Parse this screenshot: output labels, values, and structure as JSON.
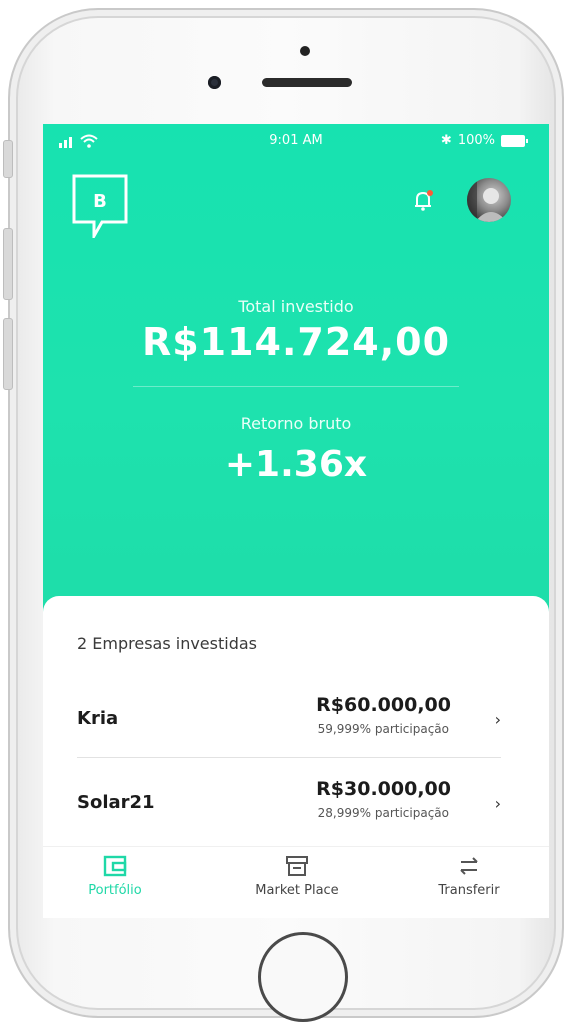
{
  "status_bar": {
    "time": "9:01 AM",
    "battery": "100%"
  },
  "header": {
    "logo_letter": "B",
    "notification_dot_color": "#ff5a36"
  },
  "summary": {
    "total_label": "Total investido",
    "total_value": "R$114.724,00",
    "return_label": "Retorno bruto",
    "return_value": "+1.36x"
  },
  "companies": {
    "title": "2 Empresas investidas",
    "items": [
      {
        "name": "Kria",
        "amount": "R$60.000,00",
        "share": "59,999% participação"
      },
      {
        "name": "Solar21",
        "amount": "R$30.000,00",
        "share": "28,999% participação"
      }
    ]
  },
  "tabs": [
    {
      "label": "Portfólio",
      "icon": "wallet-icon",
      "active": true
    },
    {
      "label": "Market Place",
      "icon": "store-icon",
      "active": false
    },
    {
      "label": "Transferir",
      "icon": "transfer-icon",
      "active": false
    }
  ],
  "colors": {
    "accent": "#1fd8a7",
    "hero": "#1ee2ae"
  }
}
